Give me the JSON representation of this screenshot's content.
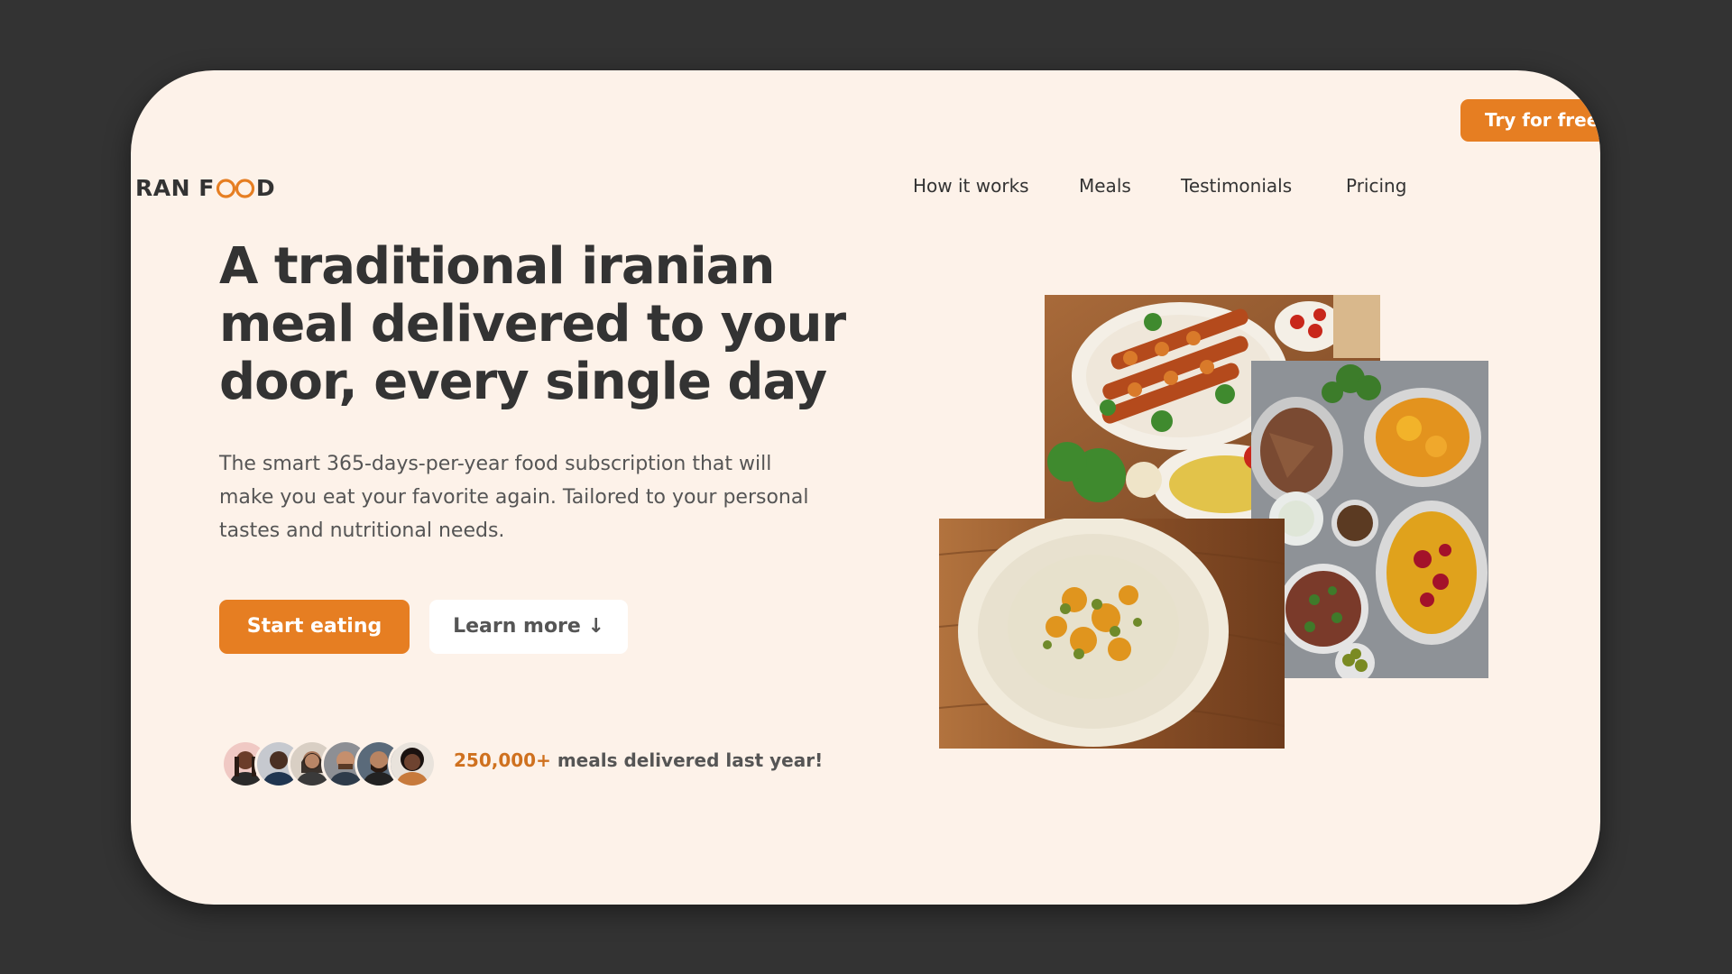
{
  "header": {
    "logo_left": "RAN F",
    "logo_right": "D",
    "nav": [
      "How it works",
      "Meals",
      "Testimonials",
      "Pricing"
    ],
    "cta_label": "Try for free"
  },
  "hero": {
    "headline": "A traditional iranian meal delivered to your door, every single day",
    "description": "The smart 365-days-per-year food subscription that will make you eat your favorite again. Tailored to your personal tastes and nutritional needs.",
    "primary_button": "Start eating",
    "secondary_button": "Learn more ↓",
    "delivered_count": "250,000+",
    "delivered_text": " meals delivered last year!"
  },
  "colors": {
    "accent": "#e67e22",
    "background": "#fdf2e9",
    "text_dark": "#333333",
    "text_body": "#555555"
  }
}
